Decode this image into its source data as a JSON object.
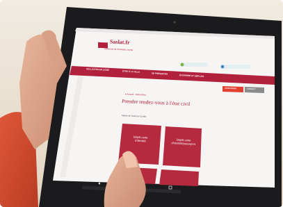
{
  "site": {
    "logo_text": "Saslat.fr",
    "tagline": "commune de Chambéry (tunis)"
  },
  "nav": {
    "items": [
      "SOLLICITER EN LIGNE",
      "ÊTRE À LA VILLE",
      "SE PRÉSENTER",
      "ÉCONOMIE ET EMPLOIS"
    ],
    "button_1": "S'IDENTIFIER",
    "button_2": "CONTACT"
  },
  "content": {
    "breadcrumb": "● Accueil › Démarches",
    "title": "Prendre rendez-vous à l'état civil",
    "section": "Mairie de Saint-la-Comté"
  },
  "tiles": [
    {
      "label": "Dépôt carte d'identité"
    },
    {
      "label": "Dépôt carte d'identité/passeport"
    }
  ],
  "colors": {
    "brand": "#b2213b",
    "tile": "#b52a3f",
    "tablet_bezel": "#1b1b1e",
    "background": "#ece3d6"
  }
}
